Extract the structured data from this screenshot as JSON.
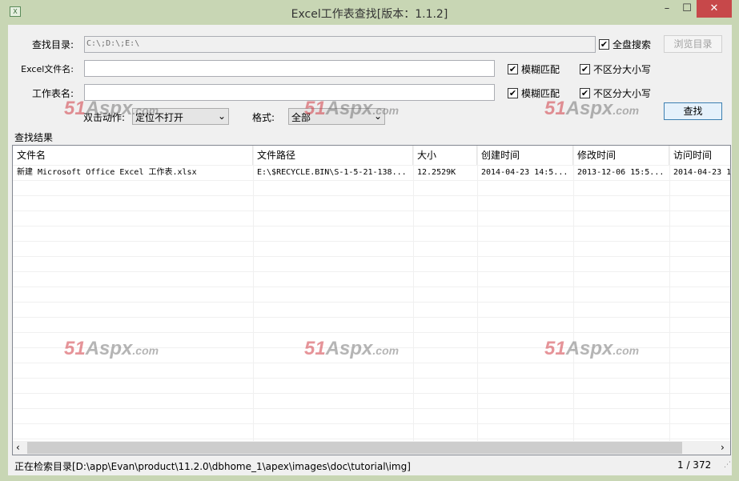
{
  "window": {
    "title": "Excel工作表查找[版本：1.1.2]",
    "minimize": "–",
    "maximize": "☐",
    "close": "✕",
    "icon": "excel-icon"
  },
  "form": {
    "dir_label": "查找目录:",
    "dir_value": "C:\\;D:\\;E:\\",
    "full_disk": "全盘搜索",
    "browse": "浏览目录",
    "file_label": "Excel文件名:",
    "file_value": "",
    "sheet_label": "工作表名:",
    "sheet_value": "",
    "fuzzy": "模糊匹配",
    "ignore_case": "不区分大小写",
    "dbl_label": "双击动作:",
    "dbl_value": "定位不打开",
    "format_label": "格式:",
    "format_value": "全部",
    "search": "查找"
  },
  "results": {
    "group_label": "查找结果",
    "columns": [
      "文件名",
      "文件路径",
      "大小",
      "创建时间",
      "修改时间",
      "访问时间"
    ],
    "rows": [
      [
        "新建 Microsoft Office Excel 工作表.xlsx",
        "E:\\$RECYCLE.BIN\\S-1-5-21-138...",
        "12.2529K",
        "2014-04-23 14:5...",
        "2013-12-06 15:5...",
        "2014-04-23 1"
      ]
    ]
  },
  "status": {
    "text": "正在检索目录[D:\\app\\Evan\\product\\11.2.0\\dbhome_1\\apex\\images\\doc\\tutorial\\img]",
    "progress": "1 / 372"
  },
  "watermark": "51Aspx.com"
}
